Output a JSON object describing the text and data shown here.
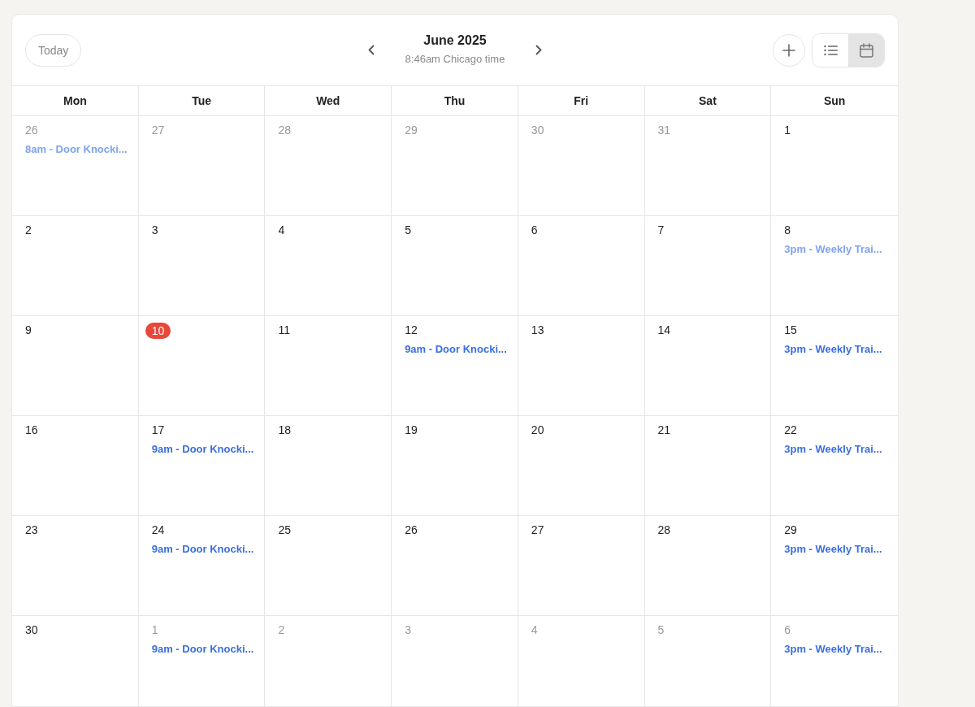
{
  "header": {
    "today_button": "Today",
    "title": "June 2025",
    "subtitle": "8:46am Chicago time",
    "views": [
      {
        "kind": "list",
        "selected": false
      },
      {
        "kind": "calendar",
        "selected": true
      }
    ]
  },
  "weekdays": [
    "Mon",
    "Tue",
    "Wed",
    "Thu",
    "Fri",
    "Sat",
    "Sun"
  ],
  "weeks": [
    {
      "days": [
        {
          "day": "26",
          "outside_month": true,
          "today": false,
          "events": [
            {
              "label": "8am - Door Knocki...",
              "past": true
            }
          ]
        },
        {
          "day": "27",
          "outside_month": true,
          "today": false
        },
        {
          "day": "28",
          "outside_month": true,
          "today": false
        },
        {
          "day": "29",
          "outside_month": true,
          "today": false
        },
        {
          "day": "30",
          "outside_month": true,
          "today": false
        },
        {
          "day": "31",
          "outside_month": true,
          "today": false
        },
        {
          "day": "1",
          "outside_month": false,
          "today": false
        }
      ]
    },
    {
      "days": [
        {
          "day": "2",
          "outside_month": false,
          "today": false
        },
        {
          "day": "3",
          "outside_month": false,
          "today": false
        },
        {
          "day": "4",
          "outside_month": false,
          "today": false
        },
        {
          "day": "5",
          "outside_month": false,
          "today": false
        },
        {
          "day": "6",
          "outside_month": false,
          "today": false
        },
        {
          "day": "7",
          "outside_month": false,
          "today": false
        },
        {
          "day": "8",
          "outside_month": false,
          "today": false,
          "events": [
            {
              "label": "3pm - Weekly Trai...",
              "past": true
            }
          ]
        }
      ]
    },
    {
      "days": [
        {
          "day": "9",
          "outside_month": false,
          "today": false
        },
        {
          "day": "10",
          "outside_month": false,
          "today": true
        },
        {
          "day": "11",
          "outside_month": false,
          "today": false
        },
        {
          "day": "12",
          "outside_month": false,
          "today": false,
          "events": [
            {
              "label": "9am - Door Knocki...",
              "past": false
            }
          ]
        },
        {
          "day": "13",
          "outside_month": false,
          "today": false
        },
        {
          "day": "14",
          "outside_month": false,
          "today": false
        },
        {
          "day": "15",
          "outside_month": false,
          "today": false,
          "events": [
            {
              "label": "3pm - Weekly Trai...",
              "past": false
            }
          ]
        }
      ]
    },
    {
      "days": [
        {
          "day": "16",
          "outside_month": false,
          "today": false
        },
        {
          "day": "17",
          "outside_month": false,
          "today": false,
          "events": [
            {
              "label": "9am - Door Knocki...",
              "past": false
            }
          ]
        },
        {
          "day": "18",
          "outside_month": false,
          "today": false
        },
        {
          "day": "19",
          "outside_month": false,
          "today": false
        },
        {
          "day": "20",
          "outside_month": false,
          "today": false
        },
        {
          "day": "21",
          "outside_month": false,
          "today": false
        },
        {
          "day": "22",
          "outside_month": false,
          "today": false,
          "events": [
            {
              "label": "3pm - Weekly Trai...",
              "past": false
            }
          ]
        }
      ]
    },
    {
      "days": [
        {
          "day": "23",
          "outside_month": false,
          "today": false
        },
        {
          "day": "24",
          "outside_month": false,
          "today": false,
          "events": [
            {
              "label": "9am - Door Knocki...",
              "past": false
            }
          ]
        },
        {
          "day": "25",
          "outside_month": false,
          "today": false
        },
        {
          "day": "26",
          "outside_month": false,
          "today": false
        },
        {
          "day": "27",
          "outside_month": false,
          "today": false
        },
        {
          "day": "28",
          "outside_month": false,
          "today": false
        },
        {
          "day": "29",
          "outside_month": false,
          "today": false,
          "events": [
            {
              "label": "3pm - Weekly Trai...",
              "past": false
            }
          ]
        }
      ]
    },
    {
      "days": [
        {
          "day": "30",
          "outside_month": false,
          "today": false
        },
        {
          "day": "1",
          "outside_month": true,
          "today": false,
          "events": [
            {
              "label": "9am - Door Knocki...",
              "past": false
            }
          ]
        },
        {
          "day": "2",
          "outside_month": true,
          "today": false
        },
        {
          "day": "3",
          "outside_month": true,
          "today": false
        },
        {
          "day": "4",
          "outside_month": true,
          "today": false
        },
        {
          "day": "5",
          "outside_month": true,
          "today": false
        },
        {
          "day": "6",
          "outside_month": true,
          "today": false,
          "events": [
            {
              "label": "3pm - Weekly Trai...",
              "past": false
            }
          ]
        }
      ]
    }
  ]
}
